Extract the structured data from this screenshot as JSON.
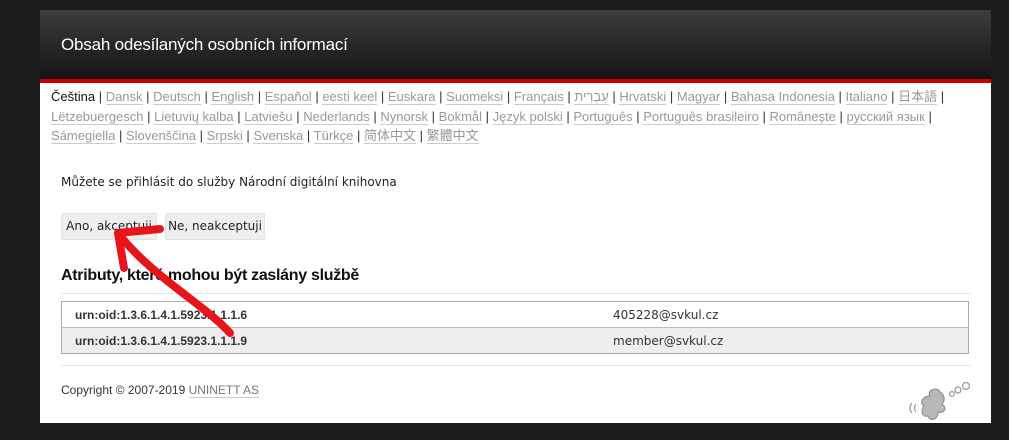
{
  "header": {
    "title": "Obsah odesílaných osobních informací"
  },
  "languages": [
    "Čeština",
    "Dansk",
    "Deutsch",
    "English",
    "Español",
    "eesti keel",
    "Euskara",
    "Suomeksi",
    "Français",
    "עִבְרִית",
    "Hrvatski",
    "Magyar",
    "Bahasa Indonesia",
    "Italiano",
    "日本語",
    "Lëtzebuergesch",
    "Lietuvių kalba",
    "Latviešu",
    "Nederlands",
    "Nynorsk",
    "Bokmål",
    "Język polski",
    "Português",
    "Português brasileiro",
    "Românește",
    "русский язык",
    "Sámegiella",
    "Slovenščina",
    "Srpski",
    "Svenska",
    "Türkçe",
    "简体中文",
    "繁體中文"
  ],
  "current_language": "Čeština",
  "info_text": "Můžete se přihlásit do služby Národní digitální knihovna",
  "buttons": {
    "accept": "Ano, akceptuji",
    "decline": "Ne, neakceptuji"
  },
  "attributes": {
    "heading": "Atributy, které mohou být zaslány službě",
    "rows": [
      {
        "name": "urn:oid:1.3.6.1.4.1.5923.1.1.1.6",
        "value": "405228@svkul.cz"
      },
      {
        "name": "urn:oid:1.3.6.1.4.1.5923.1.1.1.9",
        "value": "member@svkul.cz"
      }
    ]
  },
  "footer": {
    "copyright_prefix": "Copyright © 2007-2019 ",
    "company": "UNINETT AS"
  },
  "colors": {
    "accent_red": "#cc0000",
    "annotation_red": "#e8141b",
    "header_dark": "#1e1e1e"
  },
  "icons": {
    "annotation": "red-arrow-icon",
    "logo": "simplesamlphp-logo-icon"
  }
}
